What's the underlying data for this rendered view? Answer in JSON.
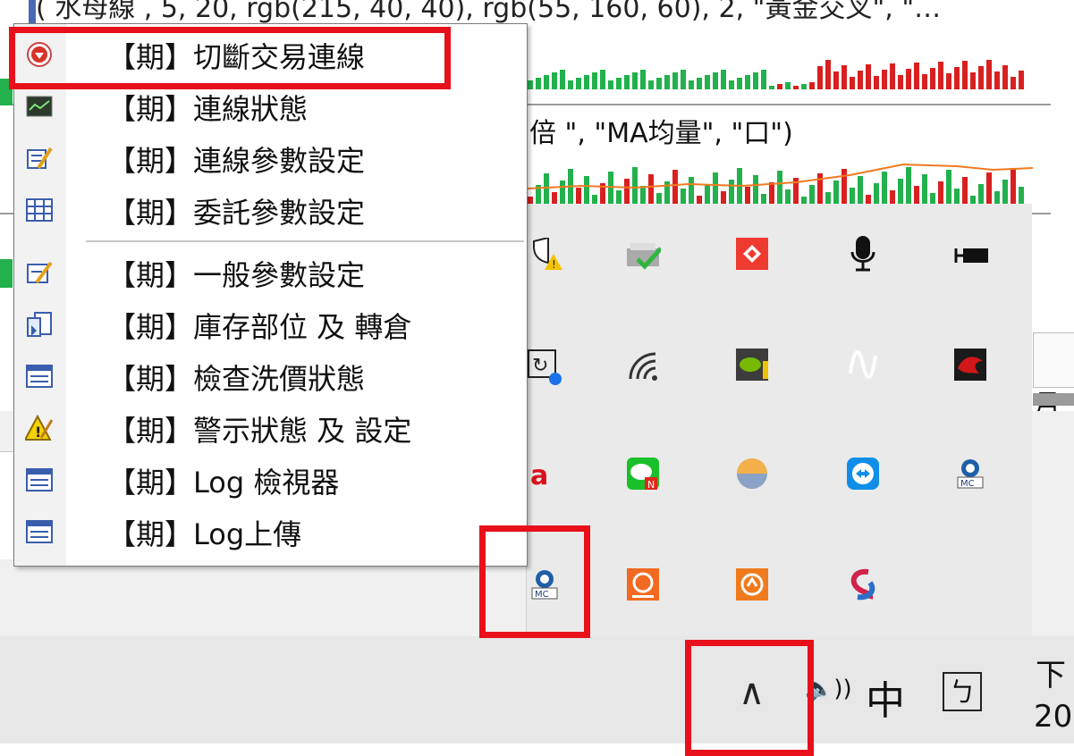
{
  "background": {
    "code_line_top": "( 水母線 , 5, 20, rgb(215, 40, 40), rgb(55, 160, 60), 2, \"黃金交叉\", \"…",
    "code_line_mid": "倍 \", \"MA均量\", \"口\")",
    "partial_right_text": "二月"
  },
  "context_menu": {
    "items": [
      {
        "label": "【期】切斷交易連線",
        "icon": "disconnect-icon"
      },
      {
        "label": "【期】連線狀態",
        "icon": "connection-status-icon"
      },
      {
        "label": "【期】連線參數設定",
        "icon": "connection-settings-icon"
      },
      {
        "label": "【期】委託參數設定",
        "icon": "order-settings-icon"
      },
      {
        "label": "【期】一般參數設定",
        "icon": "general-settings-icon"
      },
      {
        "label": "【期】庫存部位 及 轉倉",
        "icon": "inventory-icon"
      },
      {
        "label": "【期】檢查洗價狀態",
        "icon": "price-check-icon"
      },
      {
        "label": "【期】警示狀態 及 設定",
        "icon": "warning-icon"
      },
      {
        "label": "【期】Log 檢視器",
        "icon": "log-viewer-icon"
      },
      {
        "label": "【期】Log上傳",
        "icon": "log-upload-icon"
      }
    ]
  },
  "tray": {
    "icons": [
      "security-warning-icon",
      "printer-check-icon",
      "anydesk-icon",
      "microphone-icon",
      "battery-icon",
      "refresh-tray-icon",
      "wifi-icon",
      "nvidia-icon",
      "audio-wave-icon",
      "dragon-app-icon",
      "acrobat-icon",
      "line-app-icon",
      "weather-icon",
      "teamviewer-icon",
      "multicharts-icon",
      "multicharts-icon",
      "app-orange-icon",
      "app-orange-2-icon",
      "skype-icon"
    ],
    "mc_label": "MC"
  },
  "taskbar": {
    "chevron": "∧",
    "volume": "🔈))",
    "ime": "中",
    "ime_mode": "ㄅ",
    "clock_top": "下",
    "clock_bottom": "20"
  },
  "colors": {
    "highlight_red": "#e8101b",
    "bar_red": "#d92020",
    "bar_green": "#22b14c"
  }
}
